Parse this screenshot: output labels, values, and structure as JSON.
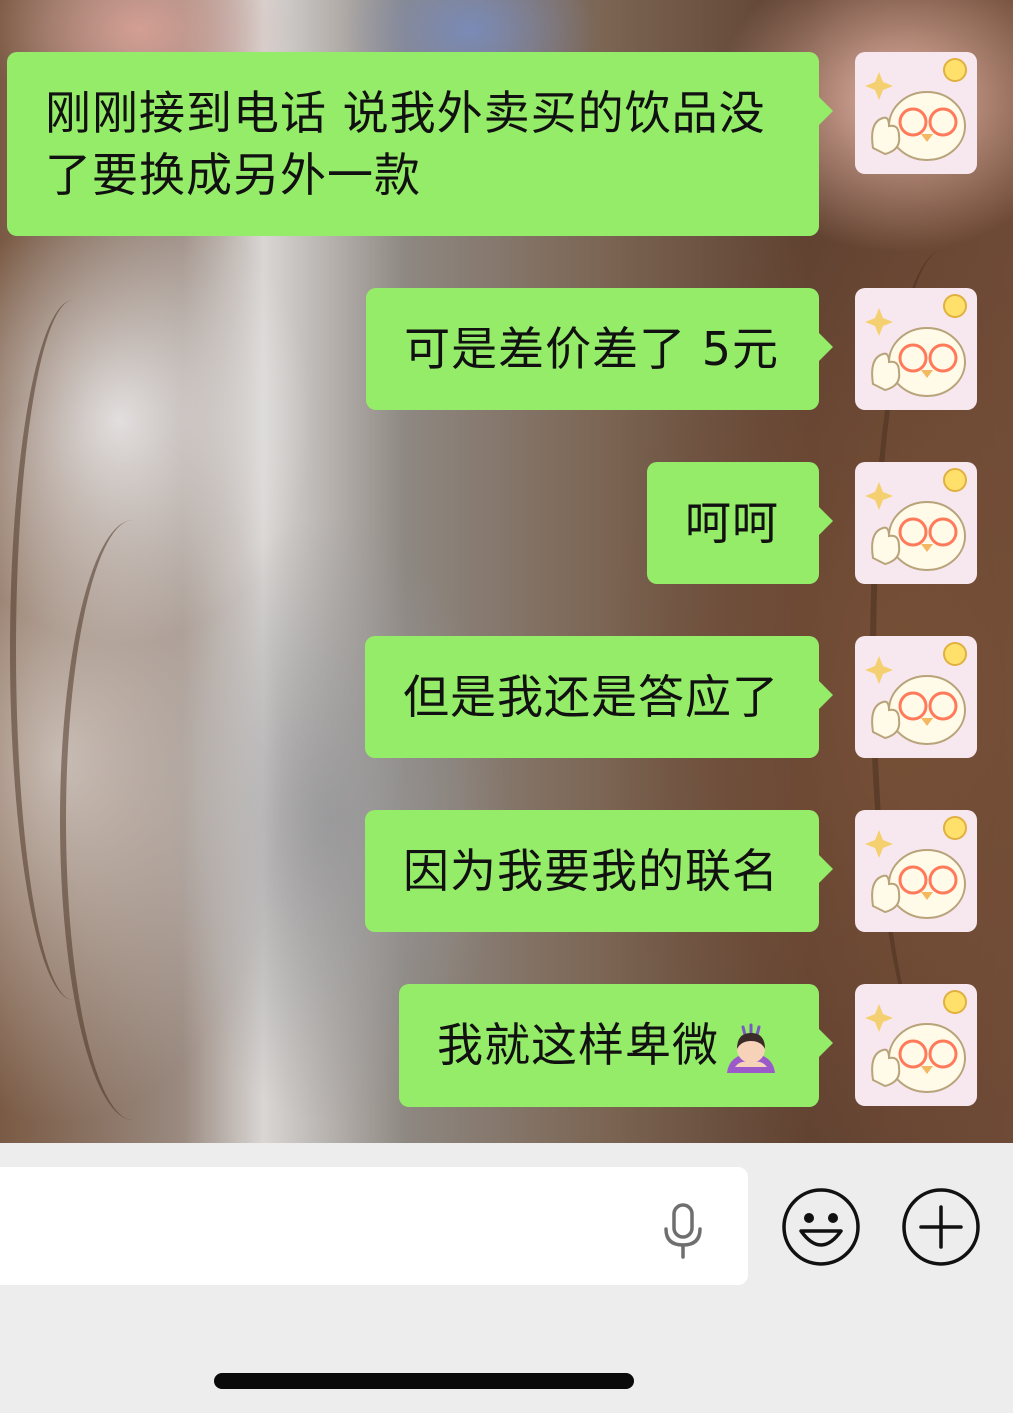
{
  "messages": [
    {
      "text": "刚刚接到电话 说我外卖买的饮品没了要换成另外一款",
      "sender": "self"
    },
    {
      "text": "可是差价差了 5元",
      "sender": "self"
    },
    {
      "text": "呵呵",
      "sender": "self"
    },
    {
      "text": "但是我还是答应了",
      "sender": "self"
    },
    {
      "text": "因为我要我的联名",
      "sender": "self"
    },
    {
      "text": "我就这样卑微",
      "sender": "self",
      "trailing_icon": "person-bowing-emoji-icon"
    }
  ],
  "input_bar": {
    "text_value": "",
    "icons": [
      "microphone-icon",
      "smiley-face-icon",
      "plus-circle-icon"
    ]
  },
  "colors": {
    "bubble_self": "#95ec69",
    "input_bar_bg": "#ededed",
    "text": "#111111"
  }
}
